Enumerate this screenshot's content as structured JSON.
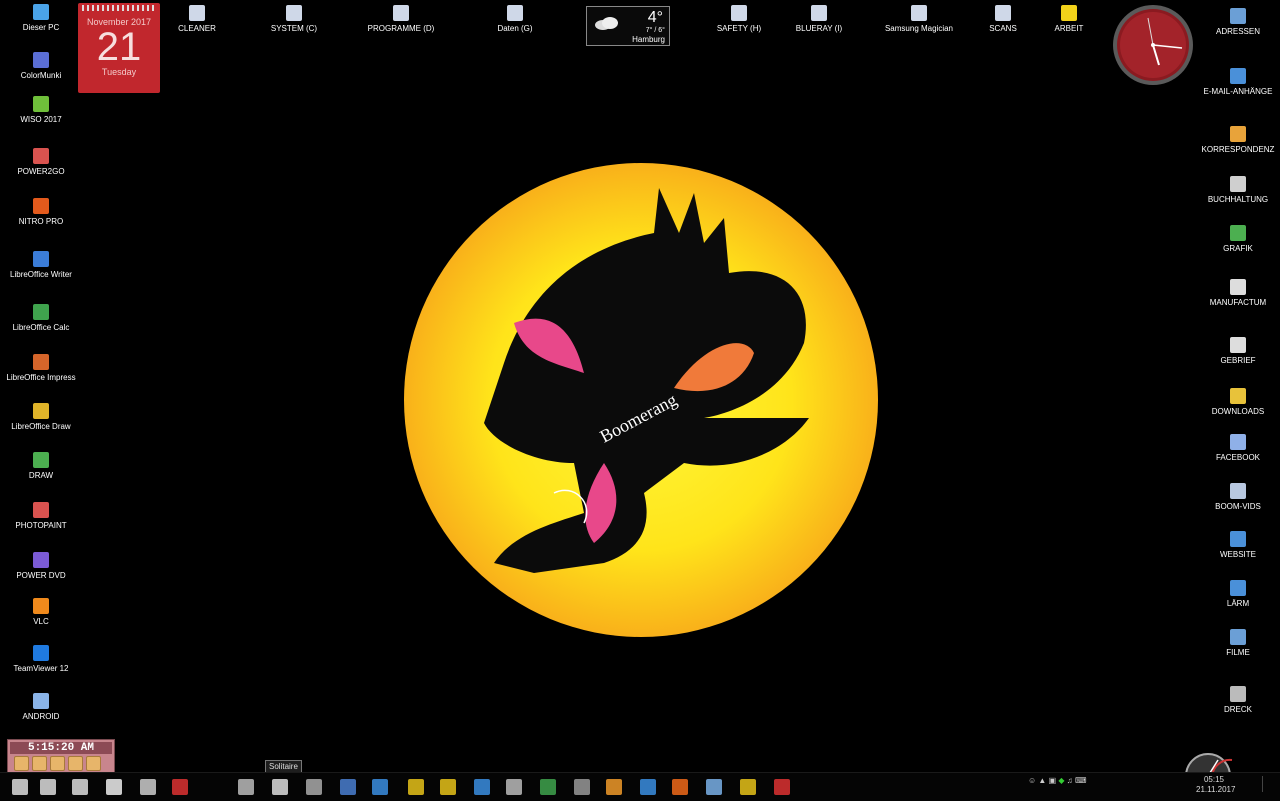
{
  "left_icons": [
    {
      "label": "Dieser PC",
      "icon": "computer-icon",
      "color": "#4aa3e8"
    },
    {
      "label": "ColorMunki",
      "icon": "colormunki-icon",
      "color": "#5b6fd6"
    },
    {
      "label": "WISO  2017",
      "icon": "wiso-icon",
      "color": "#6fbf3a"
    },
    {
      "label": "POWER2GO",
      "icon": "power2go-icon",
      "color": "#d9534f"
    },
    {
      "label": "NITRO PRO",
      "icon": "nitro-icon",
      "color": "#e35a1c"
    },
    {
      "label": "LibreOffice Writer",
      "icon": "writer-icon",
      "color": "#3b7dd8"
    },
    {
      "label": "LibreOffice Calc",
      "icon": "calc-icon",
      "color": "#3fa34d"
    },
    {
      "label": "LibreOffice Impress",
      "icon": "impress-icon",
      "color": "#d5652a"
    },
    {
      "label": "LibreOffice Draw",
      "icon": "draw-doc-icon",
      "color": "#e0b429"
    },
    {
      "label": "DRAW",
      "icon": "coreldraw-icon",
      "color": "#4caf50"
    },
    {
      "label": "PHOTOPAINT",
      "icon": "photopaint-icon",
      "color": "#d9534f"
    },
    {
      "label": "POWER DVD",
      "icon": "powerdvd-icon",
      "color": "#7b5bd6"
    },
    {
      "label": "VLC",
      "icon": "vlc-cone-icon",
      "color": "#f08a1c"
    },
    {
      "label": "TeamViewer 12",
      "icon": "teamviewer-icon",
      "color": "#1f7ae0"
    },
    {
      "label": "ANDROID",
      "icon": "android-icon",
      "color": "#8ab4e8"
    }
  ],
  "top_icons": [
    {
      "label": "CLEANER",
      "icon": "cleaner-icon"
    },
    {
      "label": "SYSTEM (C)",
      "icon": "drive-c-icon"
    },
    {
      "label": "PROGRAMME (D)",
      "icon": "drive-d-icon"
    },
    {
      "label": "Daten (G)",
      "icon": "drive-g-icon"
    },
    {
      "label": "SAFETY (H)",
      "icon": "drive-h-icon"
    },
    {
      "label": "BLUERAY (I)",
      "icon": "drive-i-icon"
    },
    {
      "label": "Samsung Magician",
      "icon": "ssd-icon"
    },
    {
      "label": "SCANS",
      "icon": "scans-folder-icon"
    },
    {
      "label": "ARBEIT",
      "icon": "star-icon"
    }
  ],
  "right_icons": [
    {
      "label": "ADRESSEN",
      "icon": "addresses-icon",
      "color": "#6b9fd6"
    },
    {
      "label": "E-MAIL-ANHÄNGE",
      "icon": "email-attachments-icon",
      "color": "#4a90d9"
    },
    {
      "label": "KORRESPONDENZ",
      "icon": "correspondence-icon",
      "color": "#e8a33a"
    },
    {
      "label": "BUCHHALTUNG",
      "icon": "accounting-icon",
      "color": "#cfcfcf"
    },
    {
      "label": "GRAFIK",
      "icon": "graphics-icon",
      "color": "#4caf50"
    },
    {
      "label": "MANUFACTUM",
      "icon": "manufactum-icon",
      "color": "#dddddd"
    },
    {
      "label": "GEBRIEF",
      "icon": "letter-icon",
      "color": "#dddddd"
    },
    {
      "label": "DOWNLOADS",
      "icon": "downloads-folder-icon",
      "color": "#e8c23a"
    },
    {
      "label": "FACEBOOK",
      "icon": "facebook-icon",
      "color": "#8fb0e8"
    },
    {
      "label": "BOOM-VIDS",
      "icon": "video-folder-icon",
      "color": "#b8c8e0"
    },
    {
      "label": "WEBSITE",
      "icon": "website-icon",
      "color": "#4a90d9"
    },
    {
      "label": "LÄRM",
      "icon": "noise-icon",
      "color": "#4a90d9"
    },
    {
      "label": "FILME",
      "icon": "films-icon",
      "color": "#6b9fd6"
    },
    {
      "label": "DRECK",
      "icon": "recycle-bin-icon",
      "color": "#bbbbbb"
    }
  ],
  "calendar": {
    "month": "November 2017",
    "day": "21",
    "weekday": "Tuesday"
  },
  "weather": {
    "temp": "4°",
    "range": "7° / 6°",
    "city": "Hamburg"
  },
  "time_widget": {
    "time": "5:15:20 AM"
  },
  "tooltip": "Solitaire",
  "logo": {
    "text": "Boomerang"
  },
  "taskbar": {
    "items": [
      "windows-start-icon",
      "search-icon",
      "task-view-icon",
      "font-app-icon",
      "calculator-icon",
      "opera-icon",
      "tower-app-icon",
      "solitaire-icon",
      "disk-app-icon",
      "steam-icon",
      "updater-icon",
      "nuclear-icon",
      "star-app-icon",
      "chart-app-icon",
      "equalizer-icon",
      "photo-app-icon",
      "graph-app-icon",
      "globe-icon",
      "cube-icon",
      "firefox-icon",
      "mail-icon",
      "picture-frame-icon",
      "vivaldi-icon"
    ],
    "clock_time": "05:15",
    "clock_date": "21.11.2017"
  }
}
